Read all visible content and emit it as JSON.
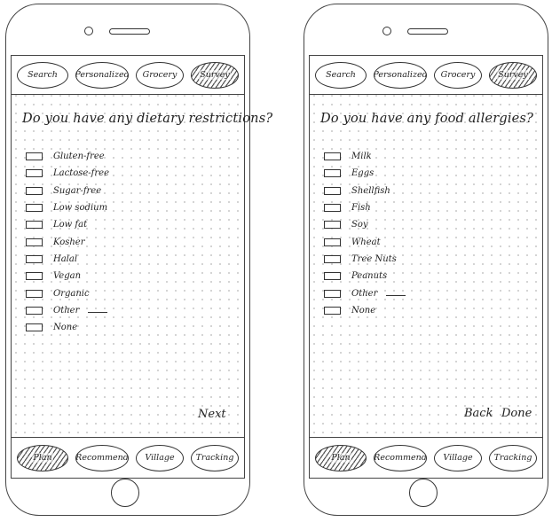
{
  "top_tabs": [
    "Search",
    "Personalized",
    "Grocery",
    "Survey"
  ],
  "bottom_tabs": [
    "Plan",
    "Recommend",
    "Village",
    "Tracking"
  ],
  "icons": {
    "camera": "camera-dot",
    "speaker": "speaker-slot",
    "home": "home-button"
  },
  "screens": [
    {
      "question": "Do you have any dietary restrictions?",
      "options": [
        "Gluten-free",
        "Lactose-free",
        "Sugar-free",
        "Low sodium",
        "Low fat",
        "Kosher",
        "Halal",
        "Vegan",
        "Organic",
        "Other",
        "None"
      ],
      "actions": [
        "Next"
      ]
    },
    {
      "question": "Do you have any food allergies?",
      "options": [
        "Milk",
        "Eggs",
        "Shellfish",
        "Fish",
        "Soy",
        "Wheat",
        "Tree Nuts",
        "Peanuts",
        "Other",
        "None"
      ],
      "actions": [
        "Back",
        "Done"
      ]
    }
  ]
}
